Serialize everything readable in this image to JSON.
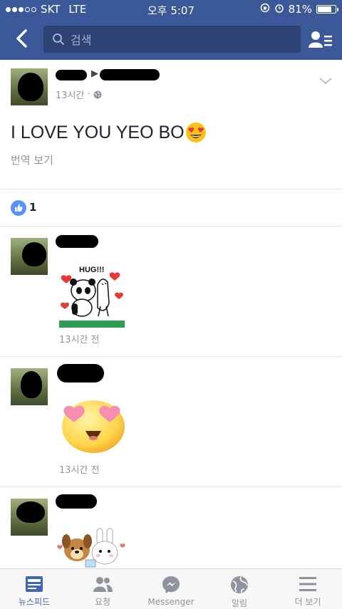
{
  "status_bar": {
    "carrier": "SKT",
    "network": "LTE",
    "time": "오후 5:07",
    "battery_text": "81%",
    "battery_level": 0.81,
    "signal_bars_filled": 3,
    "signal_bars_total": 5
  },
  "nav": {
    "search_placeholder": "검색"
  },
  "post": {
    "timestamp": "13시간",
    "separator": "·",
    "text": "I LOVE YOU YEO BO",
    "translate_link": "번역 보기",
    "like_count": "1"
  },
  "comments": [
    {
      "timestamp": "13시간 전",
      "sticker": "hug-panda-sticker",
      "sticker_text": "HUG!!!"
    },
    {
      "timestamp": "13시간 전",
      "sticker": "heart-eyes-emoji-sticker"
    },
    {
      "timestamp": "",
      "sticker": "dog-bunny-sticker"
    }
  ],
  "tabs": [
    {
      "label": "뉴스피드",
      "icon": "newsfeed-icon",
      "active": true
    },
    {
      "label": "요청",
      "icon": "friend-requests-icon",
      "active": false
    },
    {
      "label": "Messenger",
      "icon": "messenger-icon",
      "active": false
    },
    {
      "label": "알림",
      "icon": "globe-notifications-icon",
      "active": false
    },
    {
      "label": "더 보기",
      "icon": "menu-icon",
      "active": false
    }
  ],
  "colors": {
    "header_blue": "#3b5998",
    "search_bg": "#2d4373",
    "active_tab": "#4267b2",
    "like_blue": "#5890ff"
  }
}
